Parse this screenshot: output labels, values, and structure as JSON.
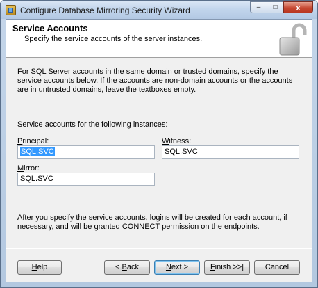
{
  "window": {
    "title": "Configure Database Mirroring Security Wizard",
    "icon": "wizard-app-icon",
    "controls": {
      "minimize": "–",
      "maximize": "□",
      "close": "x"
    }
  },
  "header": {
    "title": "Service Accounts",
    "subtitle": "Specify the service accounts of the server instances.",
    "icon": "lock-icon"
  },
  "body": {
    "description": "For SQL Server accounts in the same domain or trusted domains, specify the service accounts below. If the accounts are non-domain accounts or the accounts are in untrusted domains, leave the textboxes empty.",
    "instances_label": "Service accounts for the following instances:",
    "principal": {
      "label_hot": "P",
      "label_rest": "rincipal:",
      "value": "SQL.SVC"
    },
    "witness": {
      "label_hot": "W",
      "label_rest": "itness:",
      "value": "SQL.SVC"
    },
    "mirror": {
      "label_hot": "M",
      "label_rest": "irror:",
      "value": "SQL.SVC"
    },
    "after_text": "After you specify the service accounts, logins will be created for each account, if necessary, and will be granted CONNECT permission on the endpoints."
  },
  "buttons": {
    "help": {
      "hot": "H",
      "rest": "elp"
    },
    "back": {
      "pre": "< ",
      "hot": "B",
      "rest": "ack"
    },
    "next": {
      "hot": "N",
      "rest": "ext >"
    },
    "finish": {
      "hot": "F",
      "rest": "inish >>|"
    },
    "cancel": "Cancel"
  },
  "colors": {
    "selection": "#3399ff",
    "titlebar": "#c2d5ec",
    "close_button": "#c74a33"
  }
}
